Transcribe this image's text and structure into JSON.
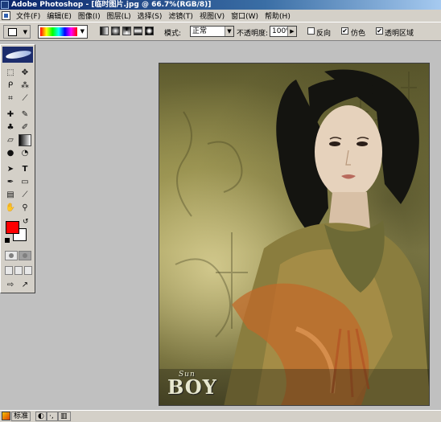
{
  "window": {
    "title": "Adobe Photoshop - [临时图片.jpg @ 66.7%(RGB/8)]"
  },
  "menu": {
    "items": [
      "文件(F)",
      "编辑(E)",
      "图像(I)",
      "图层(L)",
      "选择(S)",
      "滤镜(T)",
      "视图(V)",
      "窗口(W)",
      "帮助(H)"
    ]
  },
  "options": {
    "mode_label": "模式:",
    "mode_value": "正常",
    "opacity_label": "不透明度:",
    "opacity_value": "100%",
    "reverse_label": "反向",
    "reverse_checked": false,
    "reverse_mark": "",
    "dither_label": "仿色",
    "dither_checked": true,
    "dither_mark": "✔",
    "transparency_label": "透明区域",
    "transparency_checked": true,
    "transparency_mark": "✔"
  },
  "toolbox": {
    "foreground_color": "#ff0000",
    "background_color": "#ffffff",
    "active_tool": "gradient-tool"
  },
  "document": {
    "zoom": "66.7%",
    "watermark_main": "BOY",
    "watermark_small": "Sun"
  },
  "statusbar": {
    "ime_mode": "标准"
  },
  "colors": {
    "titlebar_start": "#0a246a",
    "titlebar_end": "#a6caf0",
    "chrome": "#d4d0c8",
    "workspace": "#c0c0c0"
  }
}
